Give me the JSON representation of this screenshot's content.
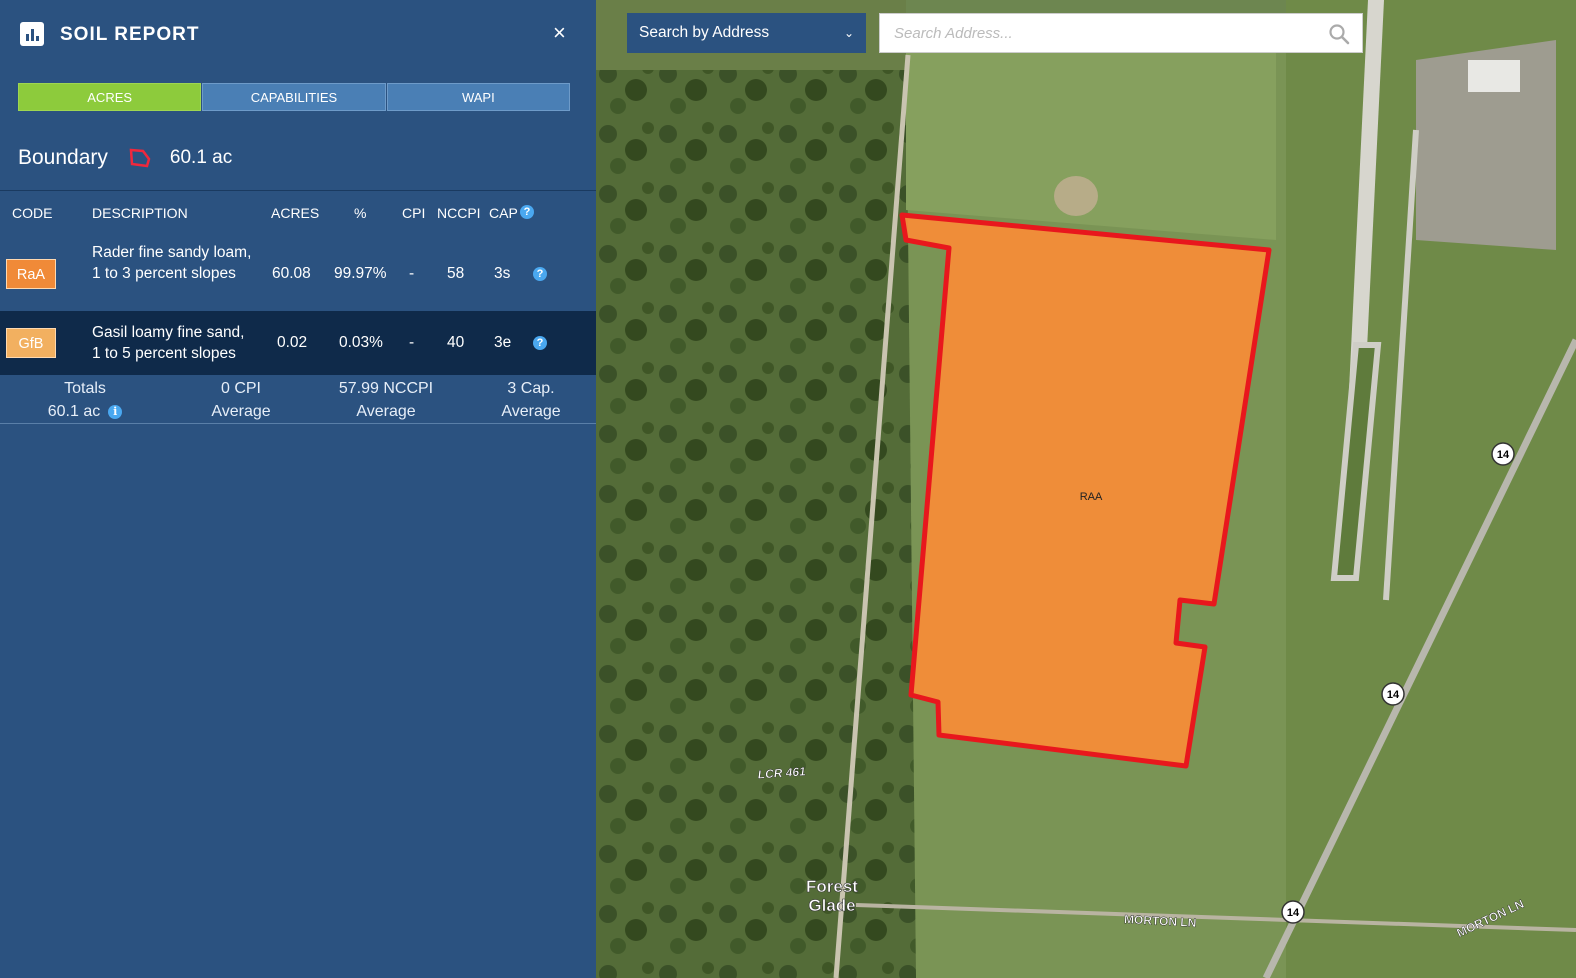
{
  "panel": {
    "title": "SOIL REPORT",
    "close_label": "×",
    "tabs": [
      {
        "label": "ACRES",
        "active": true
      },
      {
        "label": "CAPABILITIES",
        "active": false
      },
      {
        "label": "WAPI",
        "active": false
      }
    ],
    "boundary": {
      "label": "Boundary",
      "acres": "60.1 ac",
      "icon": "boundary-polygon-icon"
    },
    "columns": [
      "CODE",
      "DESCRIPTION",
      "ACRES",
      "%",
      "CPI",
      "NCCPI",
      "CAP"
    ],
    "rows": [
      {
        "code": "RaA",
        "code_color": "#f08a38",
        "description": "Rader fine sandy loam, 1 to 3 percent slopes",
        "acres": "60.08",
        "percent": "99.97%",
        "cpi": "-",
        "nccpi": "58",
        "cap": "3s"
      },
      {
        "code": "GfB",
        "code_color": "#f2b060",
        "description": "Gasil loamy fine sand, 1 to 5 percent slopes",
        "acres": "0.02",
        "percent": "0.03%",
        "cpi": "-",
        "nccpi": "40",
        "cap": "3e"
      }
    ],
    "totals": {
      "label": "Totals",
      "acres": "60.1 ac",
      "cpi": "0 CPI",
      "cpi_sub": "Average",
      "nccpi": "57.99 NCCPI",
      "nccpi_sub": "Average",
      "cap": "3 Cap.",
      "cap_sub": "Average"
    }
  },
  "search": {
    "mode": "Search by Address",
    "placeholder": "Search Address..."
  },
  "map": {
    "field_label": "RAA",
    "field_color": "#f58c38",
    "boundary_color": "#e8171d",
    "labels": {
      "road_lcr": "LCR 461",
      "town_1": "Forest",
      "town_2": "Glade",
      "road_morton_1": "MORTON LN",
      "road_morton_2": "MORTON LN"
    },
    "highway_shields": [
      "14",
      "14",
      "14"
    ]
  }
}
